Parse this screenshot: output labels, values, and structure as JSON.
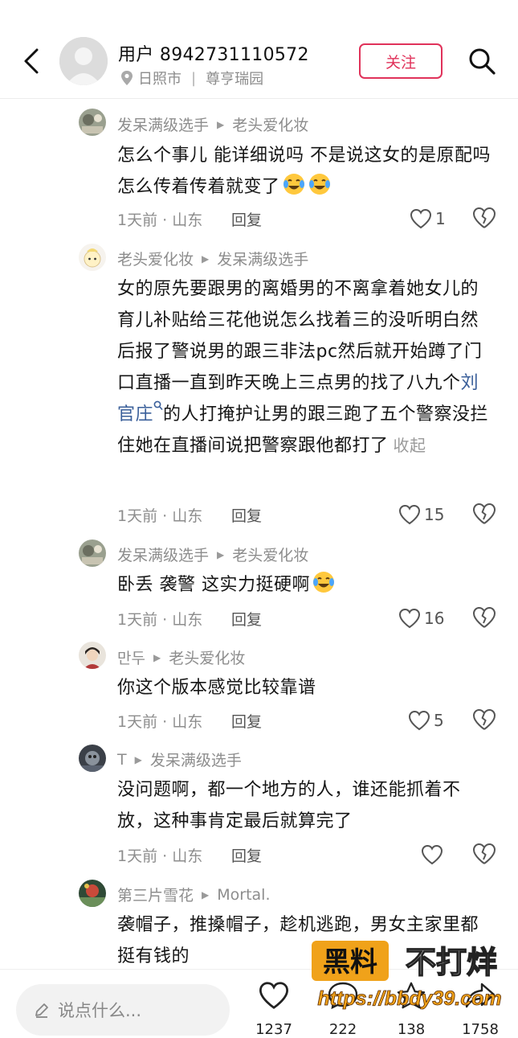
{
  "header": {
    "username": "用户 8942731110572",
    "location_city": "日照市",
    "location_place": "尊亨瑞园",
    "follow_label": "关注"
  },
  "comments": [
    {
      "author": "发呆满级选手",
      "reply_to": "老头爱化妆",
      "text": "怎么个事儿  能详细说吗  不是说这女的是原配吗  怎么传着传着就变了",
      "time_loc": "1天前 · 山东",
      "reply_label": "回复",
      "likes": "1"
    },
    {
      "author": "老头爱化妆",
      "reply_to": "发呆满级选手",
      "text_before": "女的原先要跟男的离婚男的不离拿着她女儿的育儿补贴给三花他说怎么找着三的没听明白然后报了警说男的跟三非法pc然后就开始蹲了门口直播一直到昨天晚上三点男的找了八九个",
      "link": "刘官庄",
      "text_after": "的人打掩护让男的跟三跑了五个警察没拦住她在直播间说把警察跟他都打了",
      "collapse": "收起",
      "time_loc": "1天前 · 山东",
      "reply_label": "回复",
      "likes": "15"
    },
    {
      "author": "发呆满级选手",
      "reply_to": "老头爱化妆",
      "text": "卧丢 袭警 这实力挺硬啊",
      "time_loc": "1天前 · 山东",
      "reply_label": "回复",
      "likes": "16"
    },
    {
      "author": "만두",
      "reply_to": "老头爱化妆",
      "text": "你这个版本感觉比较靠谱",
      "time_loc": "1天前 · 山东",
      "reply_label": "回复",
      "likes": "5"
    },
    {
      "author": "T",
      "reply_to": "发呆满级选手",
      "text": "没问题啊，都一个地方的人，谁还能抓着不放，这种事肯定最后就算完了",
      "time_loc": "1天前 · 山东",
      "reply_label": "回复",
      "likes": ""
    },
    {
      "author": "第三片雪花",
      "reply_to": "Mortal.",
      "text": "袭帽子，推搡帽子，趁机逃跑，男女主家里都挺有钱的"
    }
  ],
  "bottom": {
    "input_placeholder": "说点什么...",
    "like_count": "1237",
    "comment_count": "222",
    "star_count": "138",
    "share_count": "1758"
  },
  "watermark": {
    "brand_a": "黑料",
    "brand_b": "不打烊",
    "url": "https://bbdy39.com"
  },
  "colors": {
    "accent": "#e0325a",
    "link": "#3a5f9a",
    "meta": "#8d8d8d"
  }
}
